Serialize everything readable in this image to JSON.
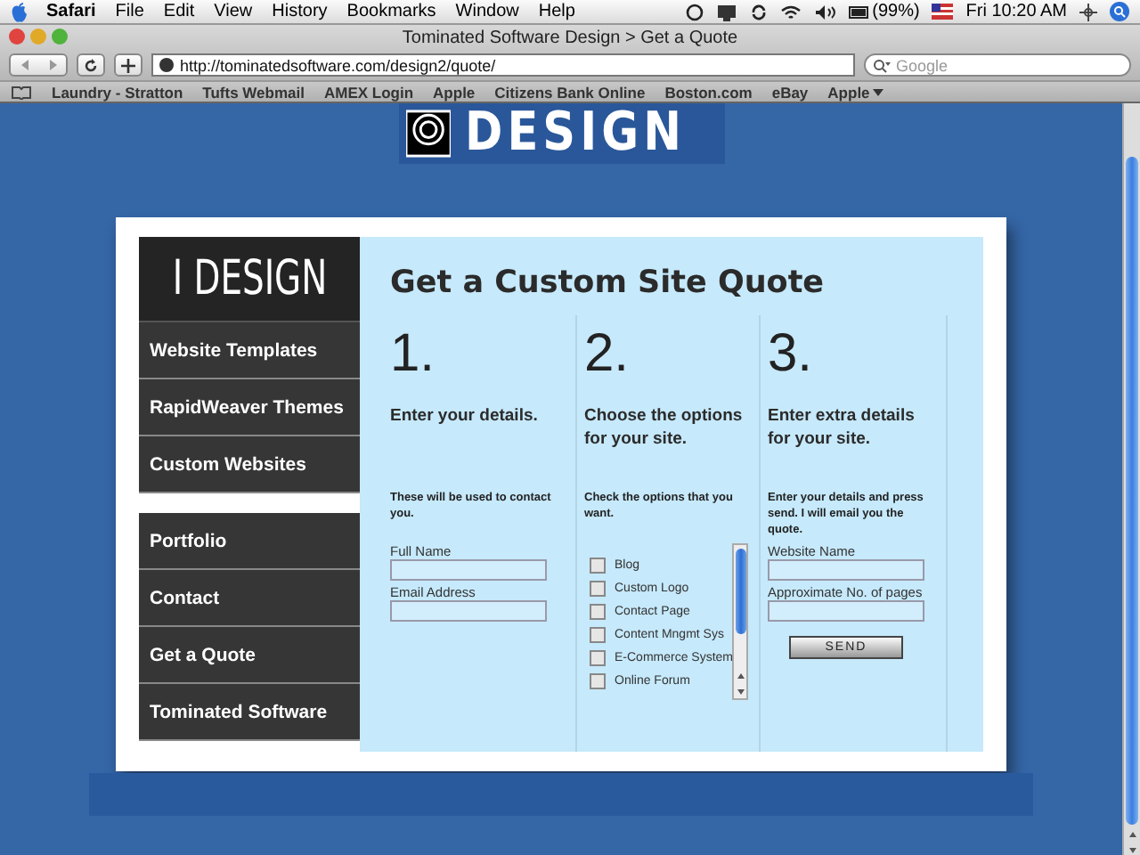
{
  "menu_bar": {
    "app": "Safari",
    "items": [
      "File",
      "Edit",
      "View",
      "History",
      "Bookmarks",
      "Window",
      "Help"
    ],
    "battery": "(99%)",
    "clock": "Fri 10:20 AM"
  },
  "window": {
    "title": "Tominated Software Design > Get a Quote"
  },
  "toolbar": {
    "url": "http://tominatedsoftware.com/design2/quote/",
    "search_placeholder": "Google"
  },
  "bookmarks": [
    {
      "label": "Laundry - Stratton",
      "kind": "link"
    },
    {
      "label": "Tufts Webmail",
      "kind": "link"
    },
    {
      "label": "AMEX Login",
      "kind": "link"
    },
    {
      "label": "Apple",
      "kind": "link"
    },
    {
      "label": "Citizens Bank Online",
      "kind": "link"
    },
    {
      "label": "Boston.com",
      "kind": "link"
    },
    {
      "label": "eBay",
      "kind": "link"
    },
    {
      "label": "Apple",
      "kind": "folder"
    }
  ],
  "banner": {
    "text": "DESIGN"
  },
  "sidebar": {
    "logo": "I DESIGN",
    "groups": [
      [
        "Website Templates",
        "RapidWeaver Themes",
        "Custom Websites"
      ],
      [
        "Portfolio",
        "Contact",
        "Get a Quote",
        "Tominated Software"
      ]
    ]
  },
  "quote": {
    "title": "Get a Custom Site Quote",
    "steps": [
      {
        "kind": "fields",
        "number": "1.",
        "heading": "Enter your details.",
        "note": "These will be used to contact you.",
        "fields": [
          {
            "label": "Full Name"
          },
          {
            "label": "Email Address"
          }
        ]
      },
      {
        "kind": "checklist",
        "number": "2.",
        "heading": "Choose the options for your site.",
        "note": "Check the options that you want.",
        "options": [
          {
            "label": "Blog",
            "checked": false
          },
          {
            "label": "Custom Logo",
            "checked": false
          },
          {
            "label": "Contact Page",
            "checked": false
          },
          {
            "label": "Content Mngmt Sys",
            "checked": false
          },
          {
            "label": "E-Commerce System",
            "checked": false
          },
          {
            "label": "Online Forum",
            "checked": false
          }
        ]
      },
      {
        "kind": "fields",
        "number": "3.",
        "heading": "Enter extra details for your site.",
        "note": "Enter your details and press send. I will email you the quote.",
        "fields": [
          {
            "label": "Website Name"
          },
          {
            "label": "Approximate No. of pages"
          }
        ],
        "button": "SEND"
      }
    ]
  }
}
